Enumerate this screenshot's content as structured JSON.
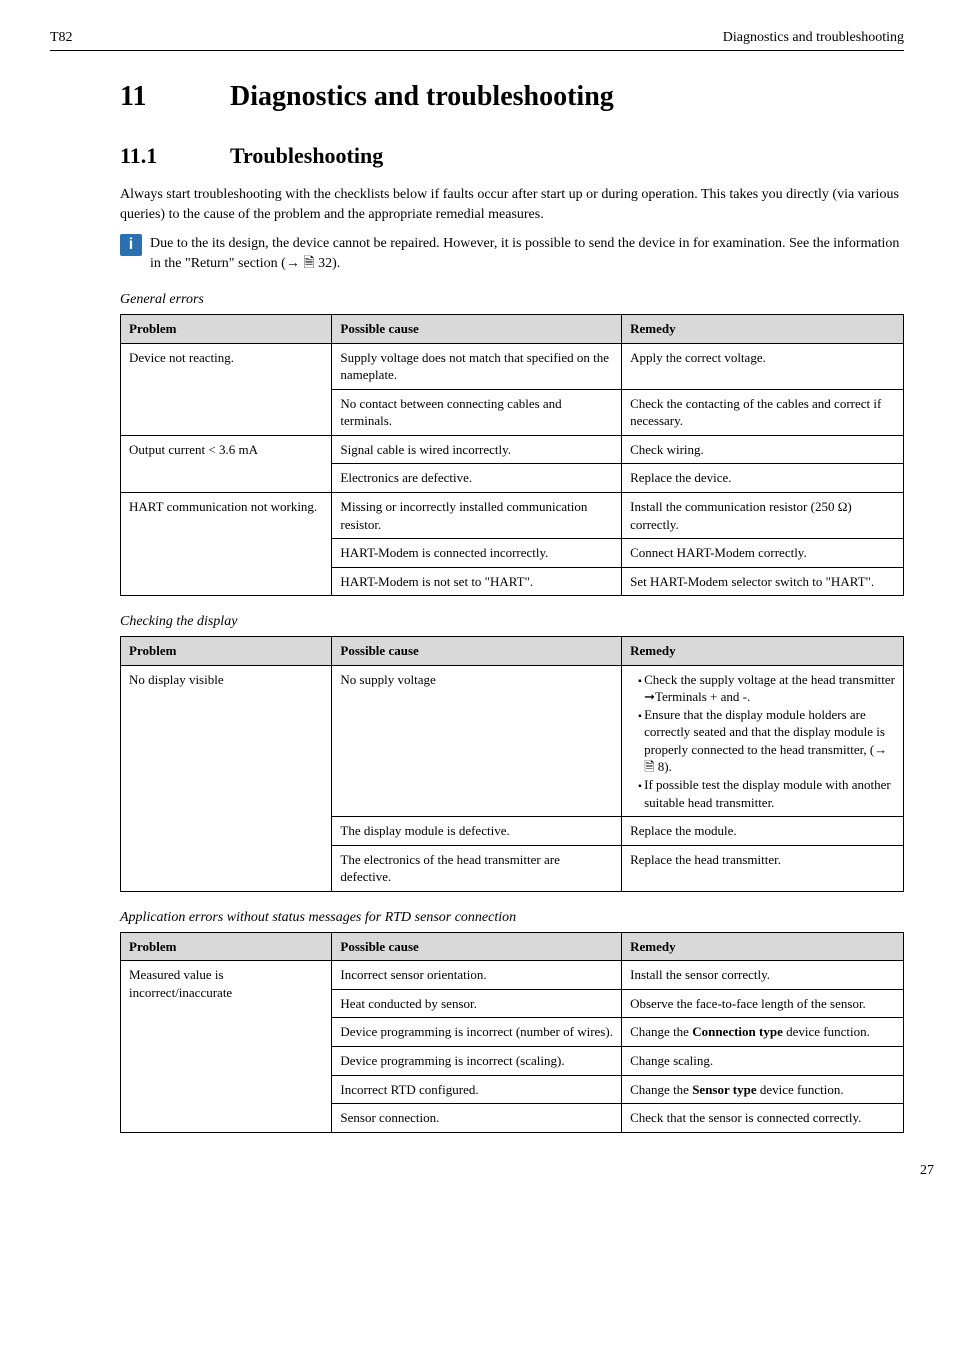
{
  "header": {
    "left": "T82",
    "right": "Diagnostics and troubleshooting"
  },
  "h1": {
    "num": "11",
    "title": "Diagnostics and troubleshooting"
  },
  "h2": {
    "num": "11.1",
    "title": "Troubleshooting"
  },
  "intro": "Always start troubleshooting with the checklists below if faults occur after start up or during operation. This takes you directly (via various queries) to the cause of the problem and the appropriate remedial measures.",
  "note": "Due to the its design, the device cannot be repaired. However, it is possible to send the device in for examination. See the information in the \"Return\" section (→ 🗎 32).",
  "table_headers": {
    "problem": "Problem",
    "cause": "Possible cause",
    "remedy": "Remedy"
  },
  "t1": {
    "caption": "General errors",
    "rows": [
      {
        "p": "Device not reacting.",
        "c": "Supply voltage does not match that specified on the nameplate.",
        "r": "Apply the correct voltage.",
        "rowspan": 2
      },
      {
        "c": "No contact between connecting cables and terminals.",
        "r": "Check the contacting of the cables and correct if necessary."
      },
      {
        "p": "Output current < 3.6 mA",
        "c": "Signal cable is wired incorrectly.",
        "r": "Check wiring.",
        "rowspan": 2
      },
      {
        "c": "Electronics are defective.",
        "r": "Replace the device."
      },
      {
        "p": "HART communication not working.",
        "c": "Missing or incorrectly installed communication resistor.",
        "r": "Install the communication resistor (250 Ω) correctly.",
        "rowspan": 3
      },
      {
        "c": "HART-Modem is connected incorrectly.",
        "r": "Connect HART-Modem correctly."
      },
      {
        "c": "HART-Modem is not set to \"HART\".",
        "r": "Set HART-Modem selector switch to \"HART\"."
      }
    ]
  },
  "t2": {
    "caption": "Checking the display",
    "rows": [
      {
        "p": "No display visible",
        "c": "No supply voltage",
        "r_list": [
          "Check the supply voltage at the head transmitter ➞Terminals + and -.",
          "Ensure that the display module holders are correctly seated and that the display module is properly connected to the head transmitter, (→ 🗎 8).",
          "If possible test the display module with another suitable head transmitter."
        ],
        "rowspan": 3
      },
      {
        "c": "The display module is defective.",
        "r": "Replace the module."
      },
      {
        "c": "The electronics of the head transmitter are defective.",
        "r": "Replace the head transmitter."
      }
    ]
  },
  "t3": {
    "caption": "Application errors without status messages for RTD sensor connection",
    "rows": [
      {
        "p": "Measured value is incorrect/inaccurate",
        "c": "Incorrect sensor orientation.",
        "r": "Install the sensor correctly.",
        "rowspan": 6
      },
      {
        "c": "Heat conducted by sensor.",
        "r": "Observe the face-to-face length of the sensor."
      },
      {
        "c": "Device programming is incorrect (number of wires).",
        "r_html": "Change the <b>Connection type</b> device function."
      },
      {
        "c": "Device programming is incorrect (scaling).",
        "r": "Change scaling."
      },
      {
        "c": "Incorrect RTD configured.",
        "r_html": "Change the <b>Sensor type</b> device function."
      },
      {
        "c": "Sensor connection.",
        "r": "Check that the sensor is connected correctly."
      }
    ]
  },
  "page_num": "27"
}
